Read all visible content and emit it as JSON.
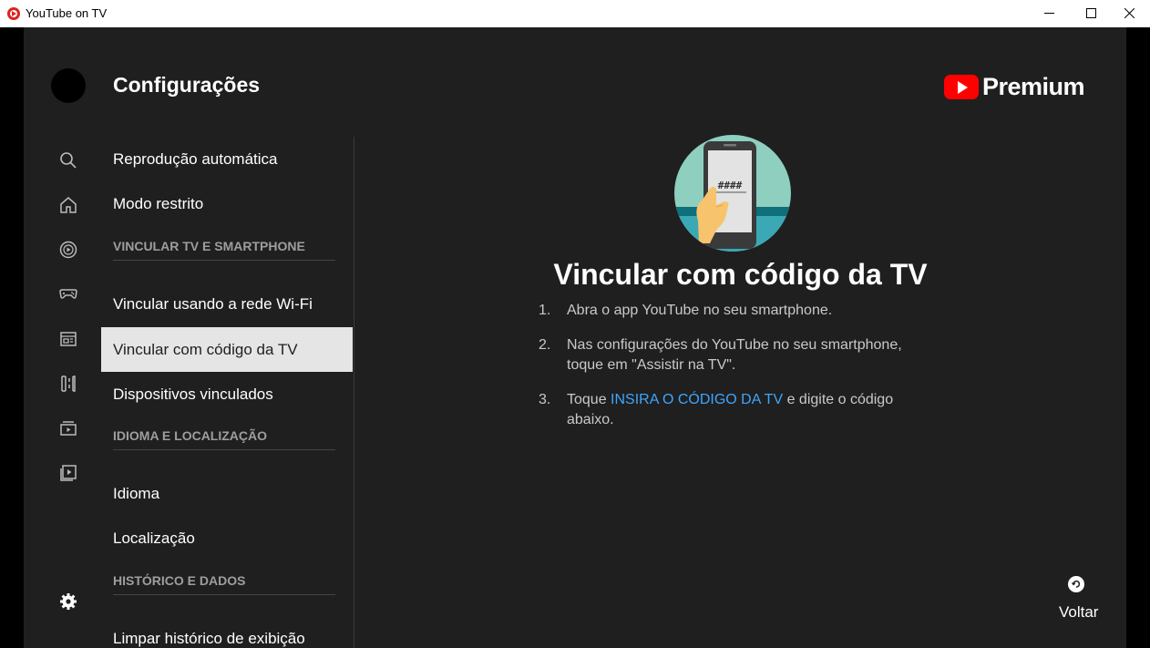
{
  "window": {
    "title": "YouTube on TV",
    "app_icon": "youtube-icon"
  },
  "header": {
    "title": "Configurações",
    "logo_text": "Premium",
    "logo_icon": "youtube-play-icon",
    "logo_color": "#ff0000"
  },
  "rail": {
    "icons": [
      "search-icon",
      "home-icon",
      "shorts-icon",
      "gaming-icon",
      "subscriptions-icon",
      "library-icon",
      "queue-icon",
      "playlist-icon",
      "settings-icon"
    ]
  },
  "menu": {
    "items": [
      {
        "type": "item",
        "label": "Reprodução automática"
      },
      {
        "type": "item",
        "label": "Modo restrito"
      },
      {
        "type": "header",
        "label": "VINCULAR TV E SMARTPHONE"
      },
      {
        "type": "item",
        "label": "Vincular usando a rede Wi-Fi"
      },
      {
        "type": "item",
        "label": "Vincular com código da TV",
        "selected": true
      },
      {
        "type": "item",
        "label": "Dispositivos vinculados"
      },
      {
        "type": "header",
        "label": "IDIOMA E LOCALIZAÇÃO"
      },
      {
        "type": "item",
        "label": "Idioma"
      },
      {
        "type": "item",
        "label": "Localização"
      },
      {
        "type": "header",
        "label": "HISTÓRICO E DADOS"
      },
      {
        "type": "item",
        "label": "Limpar histórico de exibição"
      }
    ]
  },
  "content": {
    "illustration_icon": "phone-code-illustration",
    "phone_code": "####",
    "title": "Vincular com código da TV",
    "steps": [
      {
        "num": "1.",
        "text": "Abra o app YouTube no seu smartphone."
      },
      {
        "num": "2.",
        "text": "Nas configurações do YouTube no seu smartphone, toque em \"Assistir na TV\"."
      },
      {
        "num": "3.",
        "text_before": "Toque ",
        "link": "INSIRA O CÓDIGO DA TV",
        "text_after": " e digite o código abaixo."
      }
    ],
    "link_color": "#3ea6ff"
  },
  "footer": {
    "back_label": "Voltar",
    "back_icon": "back-arrow-icon"
  }
}
